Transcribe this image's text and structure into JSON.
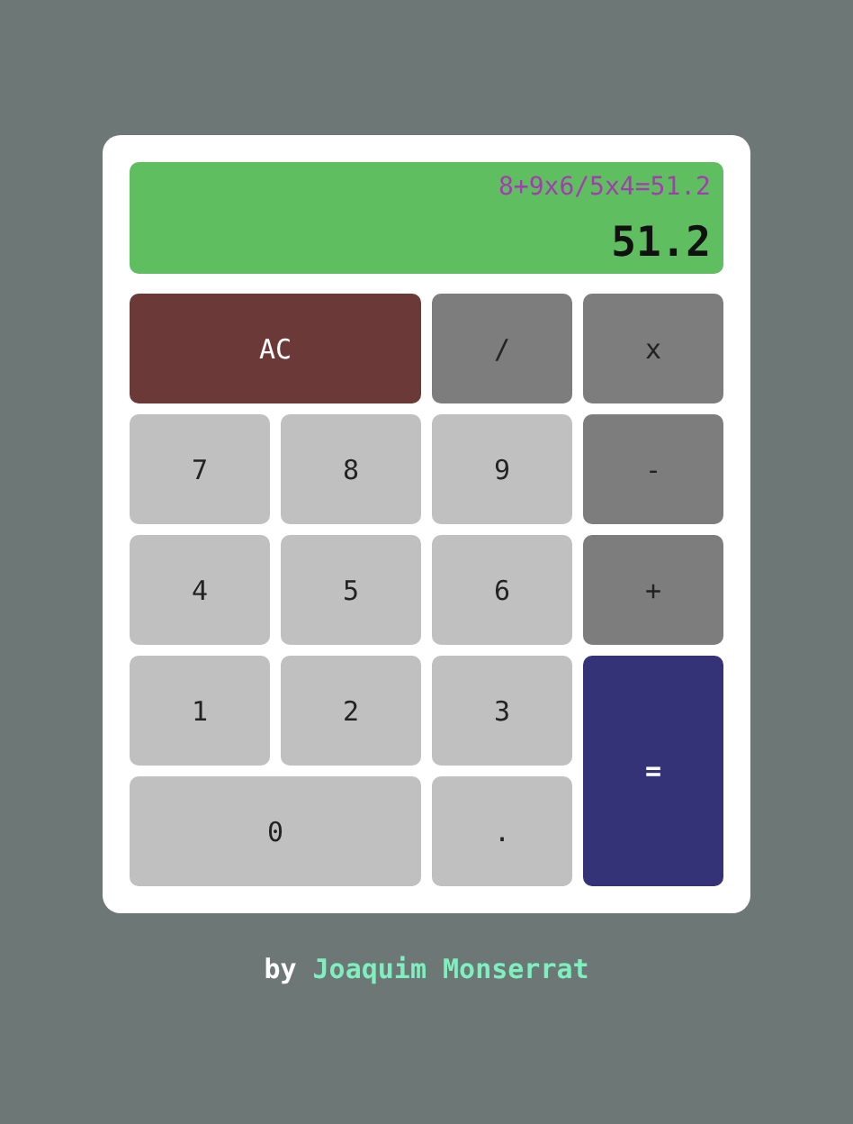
{
  "display": {
    "expression": "8+9x6/5x4=51.2",
    "result": "51.2"
  },
  "keys": [
    {
      "label": "AC",
      "kind": "clear"
    },
    {
      "label": "/",
      "kind": "operator"
    },
    {
      "label": "x",
      "kind": "operator"
    },
    {
      "label": "7",
      "kind": "number"
    },
    {
      "label": "8",
      "kind": "number"
    },
    {
      "label": "9",
      "kind": "number"
    },
    {
      "label": "-",
      "kind": "operator"
    },
    {
      "label": "4",
      "kind": "number"
    },
    {
      "label": "5",
      "kind": "number"
    },
    {
      "label": "6",
      "kind": "number"
    },
    {
      "label": "+",
      "kind": "operator"
    },
    {
      "label": "1",
      "kind": "number"
    },
    {
      "label": "2",
      "kind": "number"
    },
    {
      "label": "3",
      "kind": "number"
    },
    {
      "label": "=",
      "kind": "equals"
    },
    {
      "label": "0",
      "kind": "zero"
    },
    {
      "label": ".",
      "kind": "number"
    }
  ],
  "footer": {
    "prefix": "by",
    "author": "Joaquim Monserrat"
  }
}
